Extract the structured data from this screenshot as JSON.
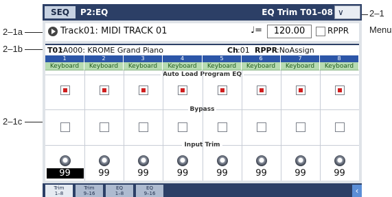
{
  "callouts": {
    "menu_num": "2–1",
    "menu_word": "Menu",
    "track": "2–1a",
    "program": "2–1b",
    "grid": "2–1c"
  },
  "header": {
    "mode_tab": "SEQ",
    "page_name": "P2:EQ",
    "right_title": "EQ Trim T01–08",
    "menu_button": "∨"
  },
  "track_row": {
    "track_name": "Track01: MIDI TRACK 01",
    "tempo_symbol": "♩=",
    "tempo_value": "120.00",
    "rppr_label": "RPPR"
  },
  "program_row": {
    "track": "T01",
    "program": ":A000: KROME Grand Piano",
    "ch_label": "Ch",
    "ch_value": ":01",
    "rppr_label": "RPPR",
    "rppr_value": ":NoAssign"
  },
  "grid": {
    "columns": [
      "1",
      "2",
      "3",
      "4",
      "5",
      "6",
      "7",
      "8"
    ],
    "keyboard_label": "Keyboard",
    "auto_load_label": "Auto Load Program EQ",
    "bypass_label": "Bypass",
    "input_trim_label": "Input Trim",
    "auto_load": [
      true,
      true,
      true,
      true,
      true,
      true,
      true,
      true
    ],
    "bypass": [
      false,
      false,
      false,
      false,
      false,
      false,
      false,
      false
    ],
    "trim_values": [
      "99",
      "99",
      "99",
      "99",
      "99",
      "99",
      "99",
      "99"
    ],
    "selected_trim_index": 0
  },
  "tabs": [
    {
      "line1": "Trim",
      "line2": "1–8",
      "active": true
    },
    {
      "line1": "Trim",
      "line2": "9–16",
      "active": false
    },
    {
      "line1": "EQ",
      "line2": "1–8",
      "active": false
    },
    {
      "line1": "EQ",
      "line2": "9–16",
      "active": false
    }
  ],
  "tab_scroll_icon": "‹",
  "colors": {
    "header": "#2c3f66",
    "column_header": "#2c56a8",
    "keyboard_cell": "#b7dbb1",
    "check_on": "#cf1f1f"
  }
}
